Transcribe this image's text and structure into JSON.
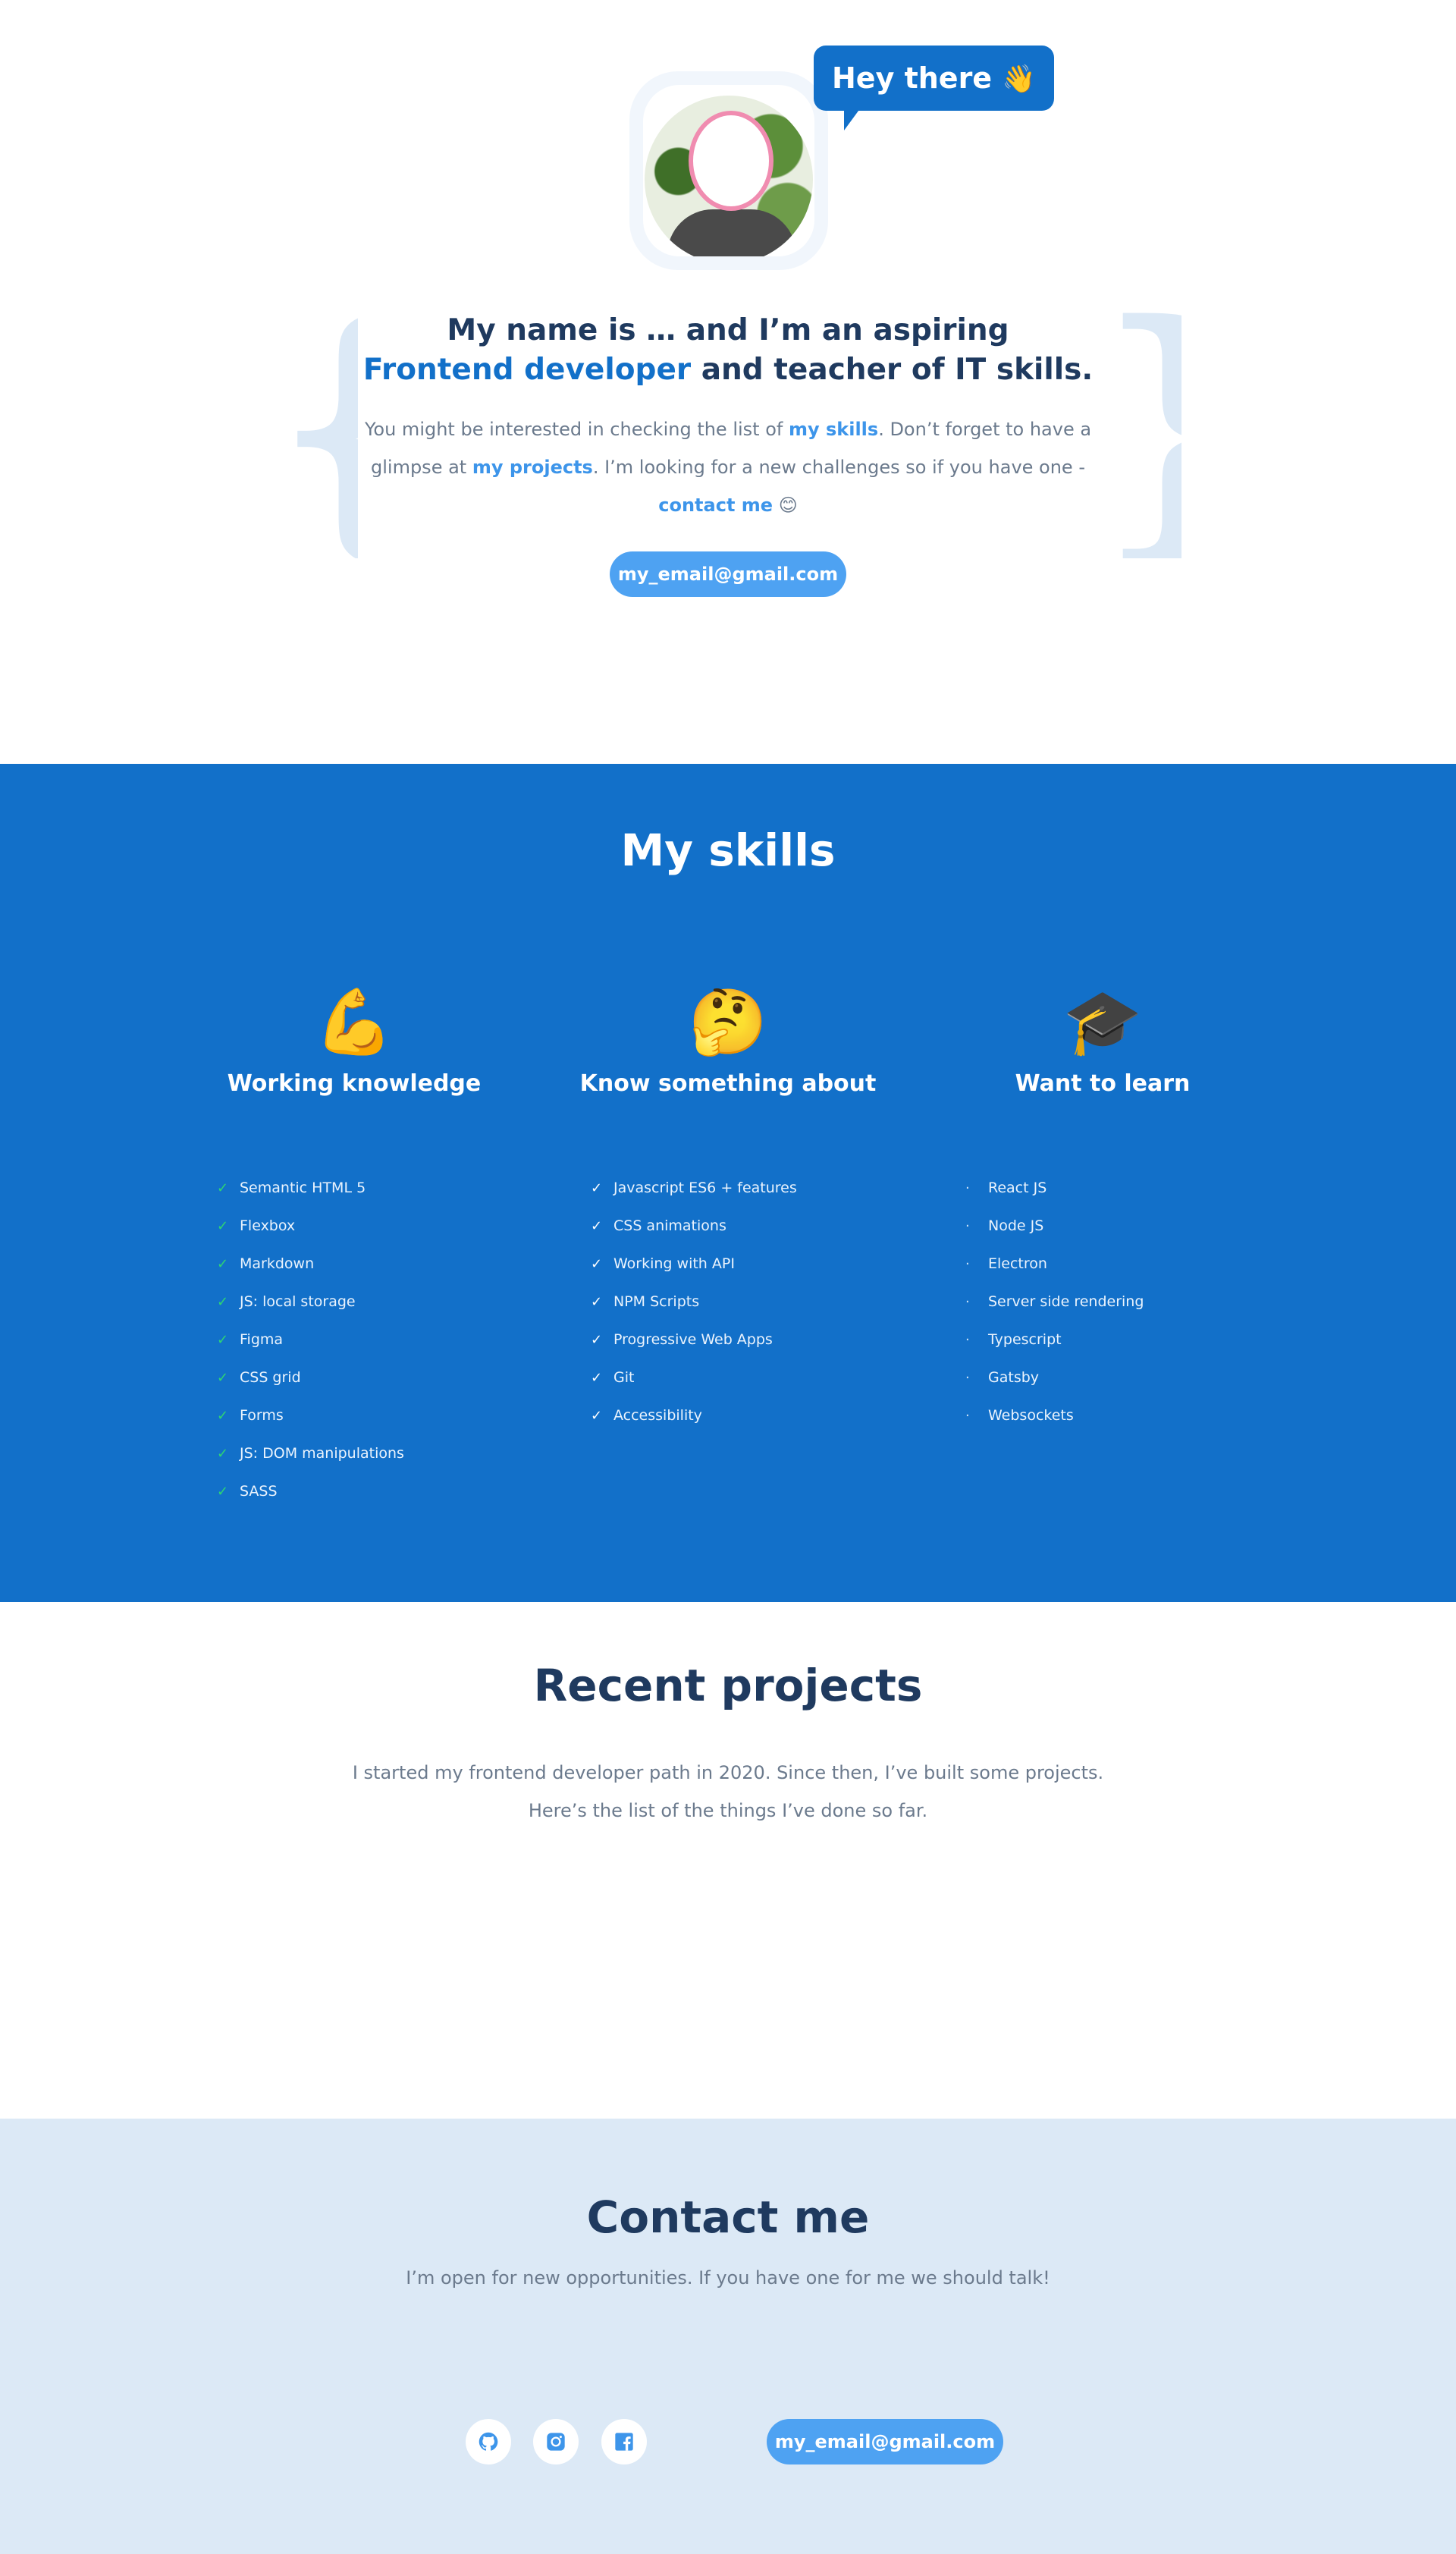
{
  "hero": {
    "greeting": "Hey there",
    "greeting_icon": "👋",
    "headline_part1": "My name is … and I’m an aspiring",
    "headline_accent": "Frontend developer",
    "headline_part2": " and teacher of IT skills.",
    "intro_part1": "You might be interested in checking the list of ",
    "skills_link": "my skills",
    "intro_part2": ". Don’t forget to have a glimpse at ",
    "projects_link": "my projects",
    "intro_part3": ". I’m looking for a new challenges so if you have one - ",
    "contact_link": "contact me",
    "intro_emoji": "😊",
    "email_button": "my_email@gmail.com"
  },
  "skills": {
    "title": "My skills",
    "columns": [
      {
        "icon": "💪",
        "icon_name": "flexed-biceps-icon",
        "heading": "Working knowledge",
        "mark": "✓",
        "items": [
          "Semantic HTML 5",
          "Flexbox",
          "Markdown",
          "JS: local storage",
          "Figma",
          "CSS grid",
          "Forms",
          "JS: DOM manipulations",
          "SASS"
        ]
      },
      {
        "icon": "🤔",
        "icon_name": "thinking-face-icon",
        "heading": "Know something about",
        "mark": "✓",
        "items": [
          "Javascript ES6 + features",
          "CSS animations",
          "Working with API",
          "NPM Scripts",
          "Progressive Web Apps",
          "Git",
          "Accessibility"
        ]
      },
      {
        "icon": "🎓",
        "icon_name": "graduation-cap-icon",
        "heading": "Want to learn",
        "mark": "·",
        "items": [
          "React JS",
          "Node JS",
          "Electron",
          "Server side rendering",
          "Typescript",
          "Gatsby",
          "Websockets"
        ]
      }
    ]
  },
  "projects": {
    "title": "Recent projects",
    "text": "I started my frontend developer path in 2020. Since then, I’ve built some projects. Here’s the list of the things I’ve done so far."
  },
  "contact": {
    "title": "Contact me",
    "text": "I’m open for new opportunities. If you have one for me we should talk!",
    "email_button": "my_email@gmail.com",
    "social_icons": [
      "github-icon",
      "instagram-icon",
      "facebook-icon"
    ]
  },
  "colors": {
    "primary": "#1270c9",
    "link": "#3d95ea",
    "button": "#4ea2f2",
    "heading": "#1f3a5f",
    "body_text": "#6b7a8d",
    "contact_bg": "#dce9f6",
    "check_green": "#2ed573"
  }
}
